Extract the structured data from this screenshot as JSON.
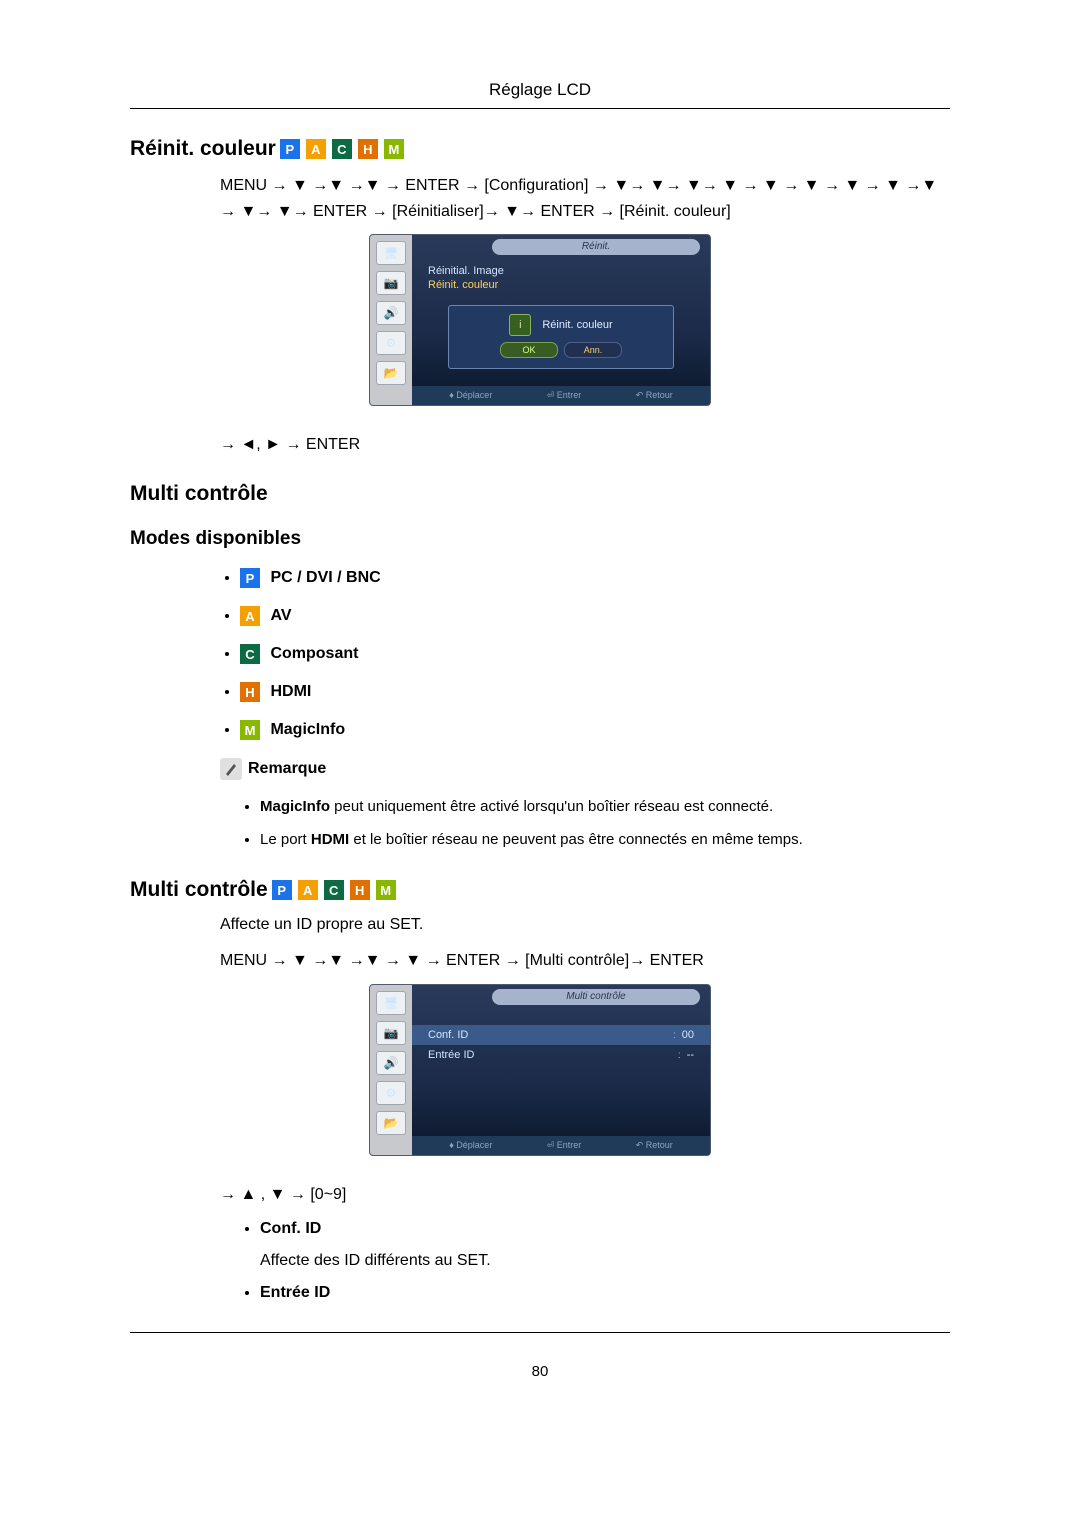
{
  "header": {
    "title": "Réglage LCD"
  },
  "page_number": "80",
  "section_reinit": {
    "title": "Réinit. couleur",
    "nav": "MENU → ▼ →▼ →▼ → ENTER → [Configuration] → ▼→ ▼→ ▼→ ▼ → ▼ → ▼ → ▼ → ▼ →▼ → ▼→ ▼→ ENTER → [Réinitialiser]→ ▼→ ENTER → [Réinit. couleur]",
    "post_nav": "→ ◄, ► → ENTER"
  },
  "osd1": {
    "tab": "Réinit.",
    "line1": "Réinitial. Image",
    "line2": "Réinit. couleur",
    "dialog_title": "Réinit. couleur",
    "btn_ok": "OK",
    "btn_ann": "Ann.",
    "footer1": "Déplacer",
    "footer2": "Entrer",
    "footer3": "Retour"
  },
  "section_multi_modes": {
    "title": "Multi contrôle",
    "subtitle": "Modes disponibles",
    "modes": {
      "p": "PC / DVI / BNC",
      "a": "AV",
      "c": "Composant",
      "h": "HDMI",
      "m": "MagicInfo"
    },
    "note_label": "Remarque",
    "note1_b": "MagicInfo",
    "note1": " peut uniquement être activé lorsqu'un boîtier réseau est connecté.",
    "note2_pre": "Le port ",
    "note2_b": "HDMI",
    "note2_post": " et le boîtier réseau ne peuvent pas être connectés en même temps."
  },
  "section_multi": {
    "title": "Multi contrôle",
    "desc": "Affecte un ID propre au SET.",
    "nav": "MENU → ▼ →▼ →▼ → ▼ → ENTER → [Multi contrôle]→ ENTER"
  },
  "osd2": {
    "tab": "Multi contrôle",
    "row1_label": "Conf. ID",
    "row1_val": "00",
    "row2_label": "Entrée ID",
    "row2_val": "--",
    "footer1": "Déplacer",
    "footer2": "Entrer",
    "footer3": "Retour"
  },
  "post_osd2": {
    "nav": "→ ▲ , ▼ → [0~9]",
    "conf_id_label": "Conf. ID",
    "conf_id_desc": "Affecte des ID différents au SET.",
    "entree_id_label": "Entrée ID"
  },
  "badges": {
    "P": "P",
    "A": "A",
    "C": "C",
    "H": "H",
    "M": "M"
  }
}
